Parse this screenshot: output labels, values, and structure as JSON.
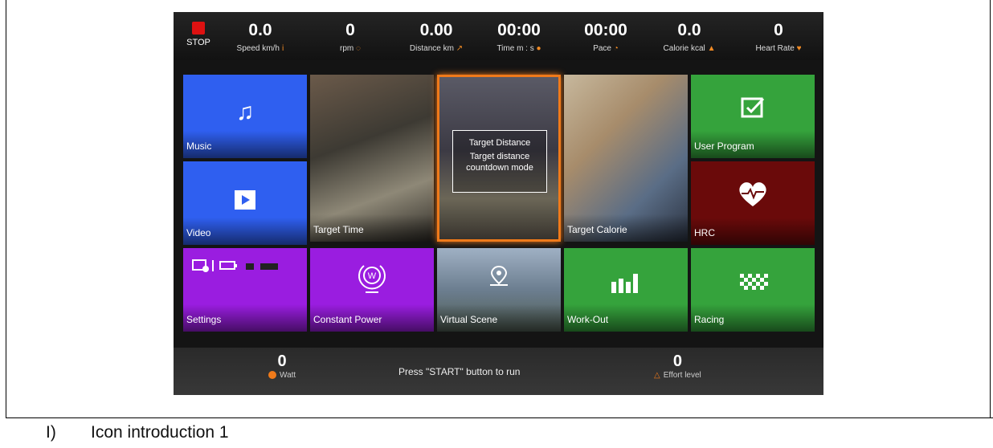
{
  "caption": {
    "number": "I)",
    "text": "Icon introduction 1"
  },
  "status": {
    "stop_label": "STOP",
    "metrics": [
      {
        "value": "0.0",
        "label": "Speed km/h"
      },
      {
        "value": "0",
        "label": "rpm"
      },
      {
        "value": "0.00",
        "label": "Distance km"
      },
      {
        "value": "00:00",
        "label": "Time m : s"
      },
      {
        "value": "00:00",
        "label": "Pace"
      },
      {
        "value": "0.0",
        "label": "Calorie kcal"
      },
      {
        "value": "0",
        "label": "Heart Rate"
      }
    ]
  },
  "tiles": {
    "music": "Music",
    "video": "Video",
    "target_time": "Target Time",
    "target_distance": {
      "title": "Target Distance",
      "desc_line1": "Target distance",
      "desc_line2": "countdown mode"
    },
    "target_calorie": "Target Calorie",
    "user_program": "User Program",
    "hrc": "HRC",
    "settings": "Settings",
    "constant_power": "Constant Power",
    "constant_power_icon_letter": "W",
    "virtual_scene": "Virtual Scene",
    "work_out": "Work-Out",
    "racing": "Racing"
  },
  "footer": {
    "watt_value": "0",
    "watt_label": "Watt",
    "message": "Press \"START\" button to run",
    "effort_value": "0",
    "effort_label": "Effort level"
  },
  "colors": {
    "accent": "#f07a1a",
    "tile_blue": "#2f5ff0",
    "tile_green": "#35a33c",
    "tile_maroon": "#6a0a0a",
    "tile_purple": "#9a1de0",
    "stop_red": "#dd1111"
  }
}
